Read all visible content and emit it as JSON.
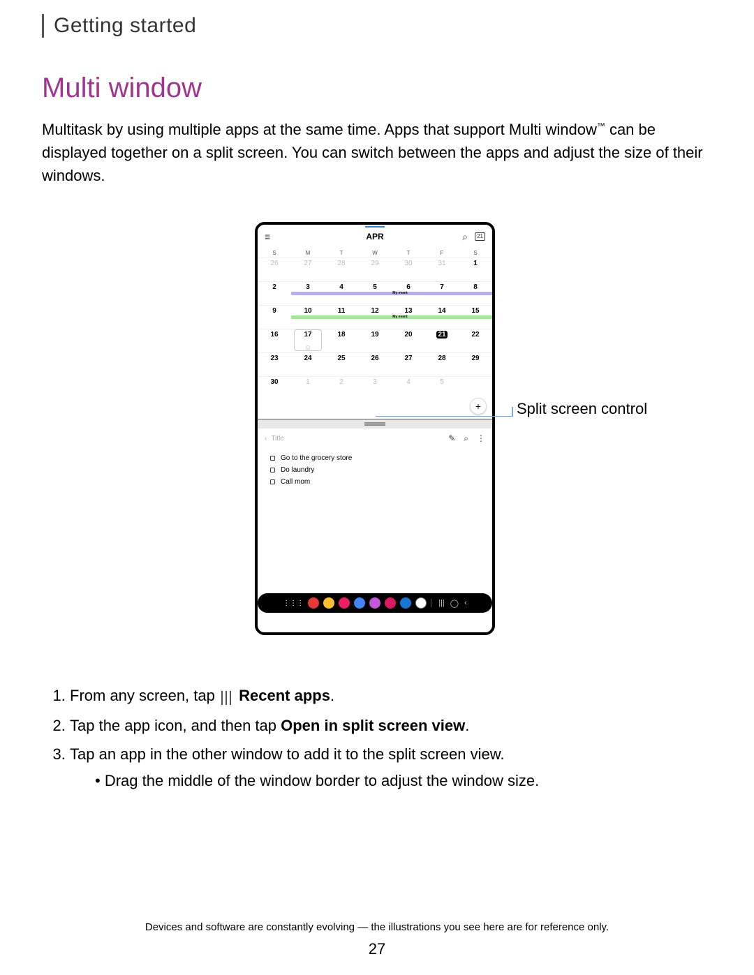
{
  "breadcrumb": "Getting started",
  "title": "Multi window",
  "intro_pre": "Multitask by using multiple apps at the same time. Apps that support Multi window",
  "intro_tm": "™",
  "intro_post": " can be displayed together on a split screen. You can switch between the apps and adjust the size of their windows.",
  "callout": "Split screen control",
  "calendar": {
    "month": "APR",
    "today_badge": "21",
    "days": [
      "S",
      "M",
      "T",
      "W",
      "T",
      "F",
      "S"
    ],
    "weeks": [
      [
        {
          "n": "26",
          "m": true
        },
        {
          "n": "27",
          "m": true
        },
        {
          "n": "28",
          "m": true
        },
        {
          "n": "29",
          "m": true
        },
        {
          "n": "30",
          "m": true
        },
        {
          "n": "31",
          "m": true
        },
        {
          "n": "1"
        }
      ],
      [
        {
          "n": "2"
        },
        {
          "n": "3",
          "ev": "purple",
          "evlabel": "My event"
        },
        {
          "n": "4"
        },
        {
          "n": "5"
        },
        {
          "n": "6"
        },
        {
          "n": "7"
        },
        {
          "n": "8"
        }
      ],
      [
        {
          "n": "9"
        },
        {
          "n": "10",
          "ev": "green",
          "evlabel": "My event"
        },
        {
          "n": "11"
        },
        {
          "n": "12"
        },
        {
          "n": "13"
        },
        {
          "n": "14"
        },
        {
          "n": "15"
        }
      ],
      [
        {
          "n": "16"
        },
        {
          "n": "17",
          "sel": true,
          "smiley": true
        },
        {
          "n": "18"
        },
        {
          "n": "19"
        },
        {
          "n": "20"
        },
        {
          "n": "21",
          "today": true
        },
        {
          "n": "22"
        }
      ],
      [
        {
          "n": "23"
        },
        {
          "n": "24"
        },
        {
          "n": "25"
        },
        {
          "n": "26"
        },
        {
          "n": "27"
        },
        {
          "n": "28"
        },
        {
          "n": "29"
        }
      ],
      [
        {
          "n": "30"
        },
        {
          "n": "1",
          "m": true
        },
        {
          "n": "2",
          "m": true
        },
        {
          "n": "3",
          "m": true
        },
        {
          "n": "4",
          "m": true
        },
        {
          "n": "5",
          "m": true
        },
        {
          "n": ""
        }
      ]
    ]
  },
  "notes": {
    "title_placeholder": "Title",
    "items": [
      "Go to the grocery store",
      "Do laundry",
      "Call mom"
    ]
  },
  "dock_colors": [
    "#e53935",
    "#fbc02d",
    "#e91e63",
    "#4285f4",
    "#c158dc",
    "#d81b60",
    "#1976d2",
    "#ffffff"
  ],
  "steps": {
    "s1_pre": "From any screen, tap",
    "s1_bold": "Recent apps",
    "s1_post": ".",
    "s2_pre": "Tap the app icon, and then tap ",
    "s2_bold": "Open in split screen view",
    "s2_post": ".",
    "s3": "Tap an app in the other window to add it to the split screen view.",
    "s3_sub": "Drag the middle of the window border to adjust the window size."
  },
  "footer": "Devices and software are constantly evolving — the illustrations you see here are for reference only.",
  "page_number": "27"
}
